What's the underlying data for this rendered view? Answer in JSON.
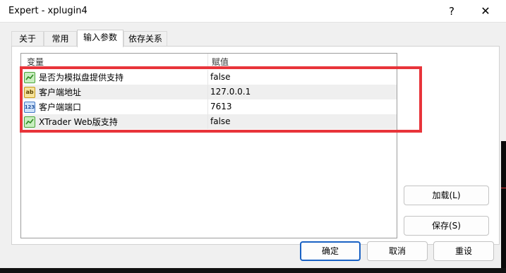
{
  "window": {
    "title": "Expert - xplugin4",
    "help_glyph": "?",
    "close_glyph": "✕"
  },
  "tabs": [
    {
      "label": "关于"
    },
    {
      "label": "常用"
    },
    {
      "label": "输入参数",
      "active": true
    },
    {
      "label": "依存关系"
    }
  ],
  "grid": {
    "columns": [
      "变量",
      "赋值"
    ],
    "rows": [
      {
        "icon": "boolean-icon",
        "name": "是否为模拟盘提供支持",
        "value": "false"
      },
      {
        "icon": "string-icon",
        "icon_text": "ab",
        "name": "客户端地址",
        "value": "127.0.0.1"
      },
      {
        "icon": "integer-icon",
        "icon_text": "123",
        "name": "客户端端口",
        "value": "7613"
      },
      {
        "icon": "boolean-icon",
        "name": "XTrader Web版支持",
        "value": "false"
      }
    ]
  },
  "side_buttons": {
    "load": "加载(L)",
    "save": "保存(S)"
  },
  "footer_buttons": {
    "ok": "确定",
    "cancel": "取消",
    "reset": "重设"
  },
  "colors": {
    "highlight": "#e8343a",
    "default_button_border": "#1a62c4"
  }
}
